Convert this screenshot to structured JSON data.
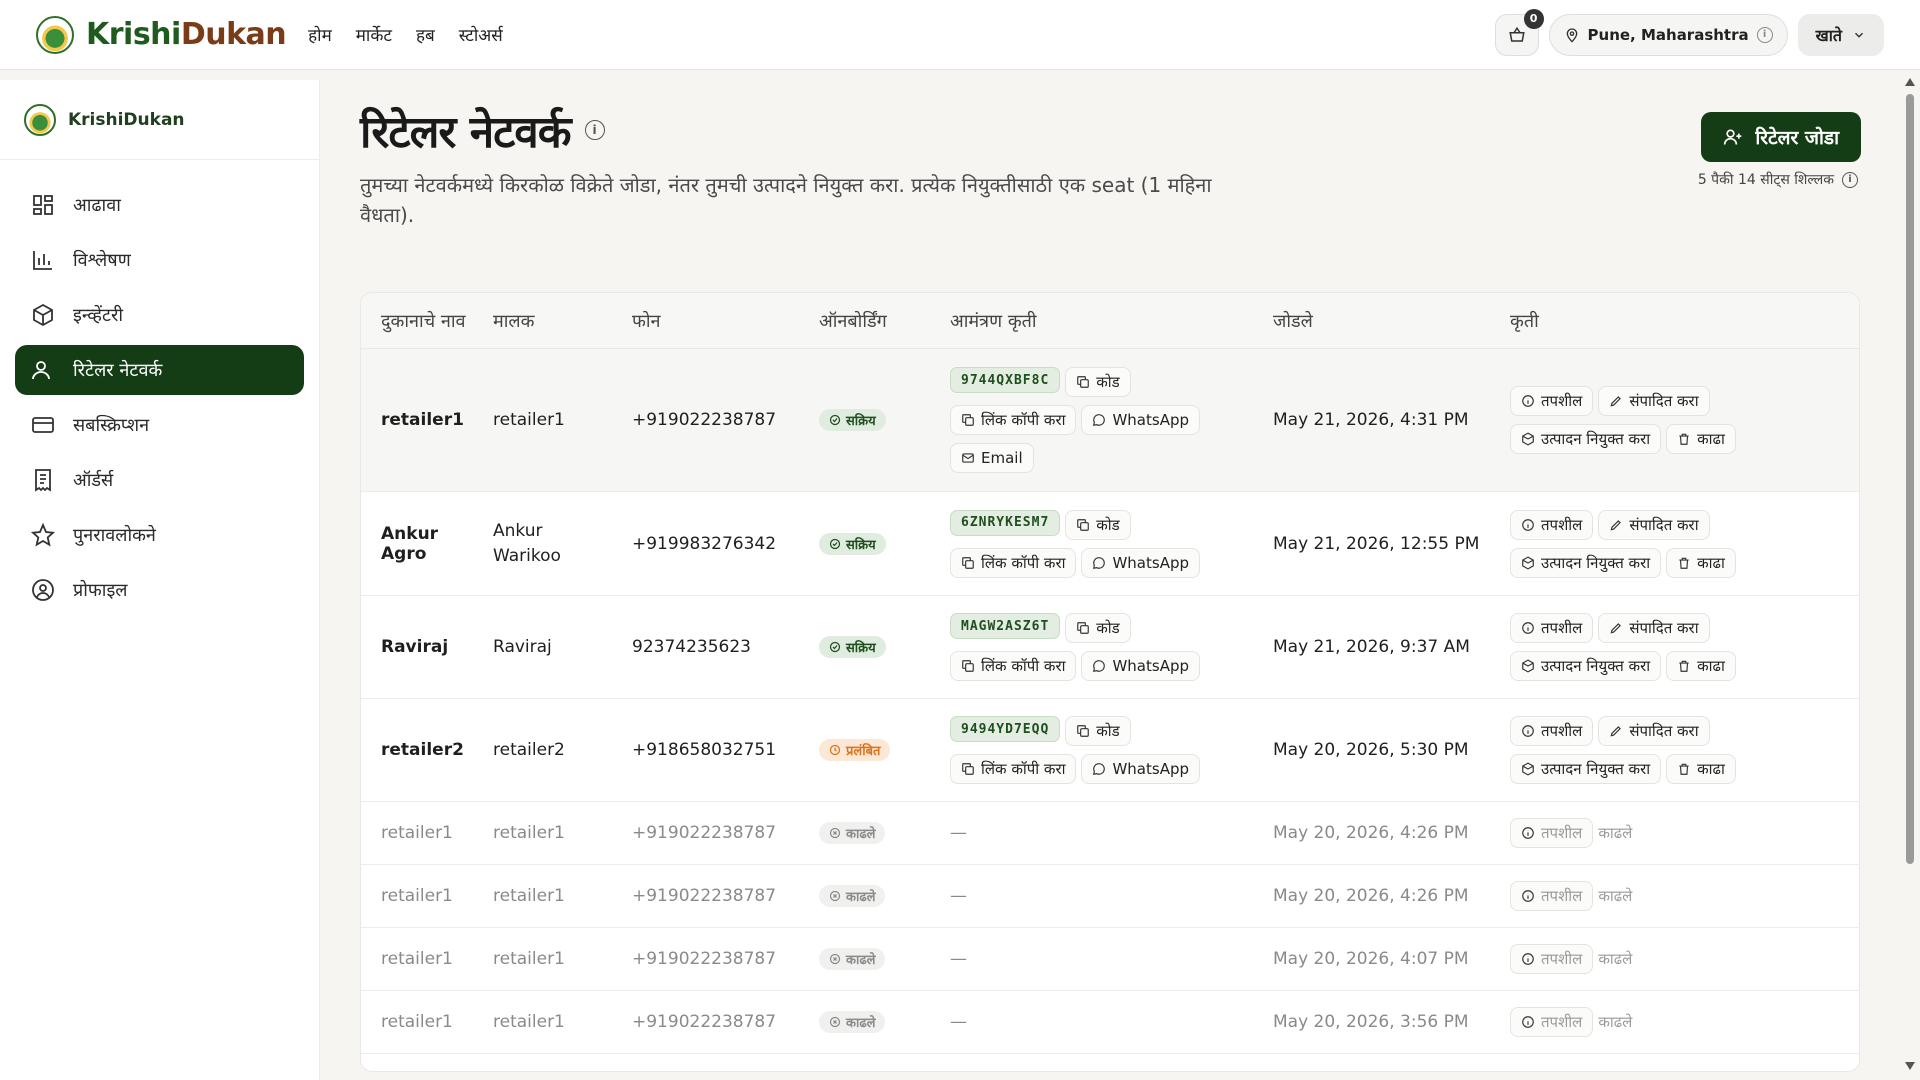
{
  "topbar": {
    "brand_k": "Krishi",
    "brand_d": "Dukan",
    "nav": [
      "होम",
      "मार्केट",
      "हब",
      "स्टोअर्स"
    ],
    "cart_count": "0",
    "location": "Pune, Maharashtra",
    "account_label": "खाते"
  },
  "sidebar": {
    "brand": "KrishiDukan",
    "items": [
      {
        "label": "आढावा",
        "icon": "dashboard-icon"
      },
      {
        "label": "विश्लेषण",
        "icon": "chart-icon"
      },
      {
        "label": "इन्व्हेंटरी",
        "icon": "box-icon"
      },
      {
        "label": "रिटेलर नेटवर्क",
        "icon": "user-icon",
        "active": true
      },
      {
        "label": "सबस्क्रिप्शन",
        "icon": "card-icon"
      },
      {
        "label": "ऑर्डर्स",
        "icon": "receipt-icon"
      },
      {
        "label": "पुनरावलोकने",
        "icon": "star-icon"
      },
      {
        "label": "प्रोफाइल",
        "icon": "profile-icon"
      }
    ]
  },
  "main": {
    "title": "रिटेलर नेटवर्क",
    "subtitle": "तुमच्या नेटवर्कमध्ये किरकोळ विक्रेते जोडा, नंतर तुमची उत्पादने नियुक्त करा. प्रत्येक नियुक्तीसाठी एक seat (1 महिना वैधता).",
    "add_button": "रिटेलर जोडा",
    "seats_text": "5 पैकी 14 सीट्स शिल्लक"
  },
  "table": {
    "headers": [
      "दुकानाचे नाव",
      "मालक",
      "फोन",
      "ऑनबोर्डिंग",
      "आमंत्रण कृती",
      "जोडले",
      "कृती"
    ],
    "labels": {
      "code": "कोड",
      "copy_link": "लिंक कॉपी करा",
      "whatsapp": "WhatsApp",
      "email": "Email",
      "details": "तपशील",
      "edit": "संपादित करा",
      "assign": "उत्पादन नियुक्त करा",
      "remove": "काढा",
      "removed": "काढले",
      "dash": "—"
    },
    "status_labels": {
      "active": "सक्रिय",
      "pending": "प्रलंबित",
      "removed": "काढले"
    },
    "rows": [
      {
        "shop": "retailer1",
        "owner": "retailer1",
        "phone": "+919022238787",
        "status": "active",
        "code": "9744QXBF8C",
        "email": true,
        "added": "May 21, 2026, 4:31 PM"
      },
      {
        "shop": "Ankur Agro",
        "owner": "Ankur Warikoo",
        "phone": "+919983276342",
        "status": "active",
        "code": "6ZNRYKESM7",
        "email": false,
        "added": "May 21, 2026, 12:55 PM"
      },
      {
        "shop": "Raviraj",
        "owner": "Raviraj",
        "phone": "92374235623",
        "status": "active",
        "code": "MAGW2ASZ6T",
        "email": false,
        "added": "May 21, 2026, 9:37 AM"
      },
      {
        "shop": "retailer2",
        "owner": "retailer2",
        "phone": "+918658032751",
        "status": "pending",
        "code": "9494YD7EQQ",
        "email": false,
        "added": "May 20, 2026, 5:30 PM"
      },
      {
        "shop": "retailer1",
        "owner": "retailer1",
        "phone": "+919022238787",
        "status": "removed",
        "added": "May 20, 2026, 4:26 PM"
      },
      {
        "shop": "retailer1",
        "owner": "retailer1",
        "phone": "+919022238787",
        "status": "removed",
        "added": "May 20, 2026, 4:26 PM"
      },
      {
        "shop": "retailer1",
        "owner": "retailer1",
        "phone": "+919022238787",
        "status": "removed",
        "added": "May 20, 2026, 4:07 PM"
      },
      {
        "shop": "retailer1",
        "owner": "retailer1",
        "phone": "+919022238787",
        "status": "removed",
        "added": "May 20, 2026, 3:56 PM"
      }
    ]
  },
  "colors": {
    "brand_green": "#143d16",
    "pending_orange": "#d9731c",
    "active_bg": "#e1ece0"
  }
}
